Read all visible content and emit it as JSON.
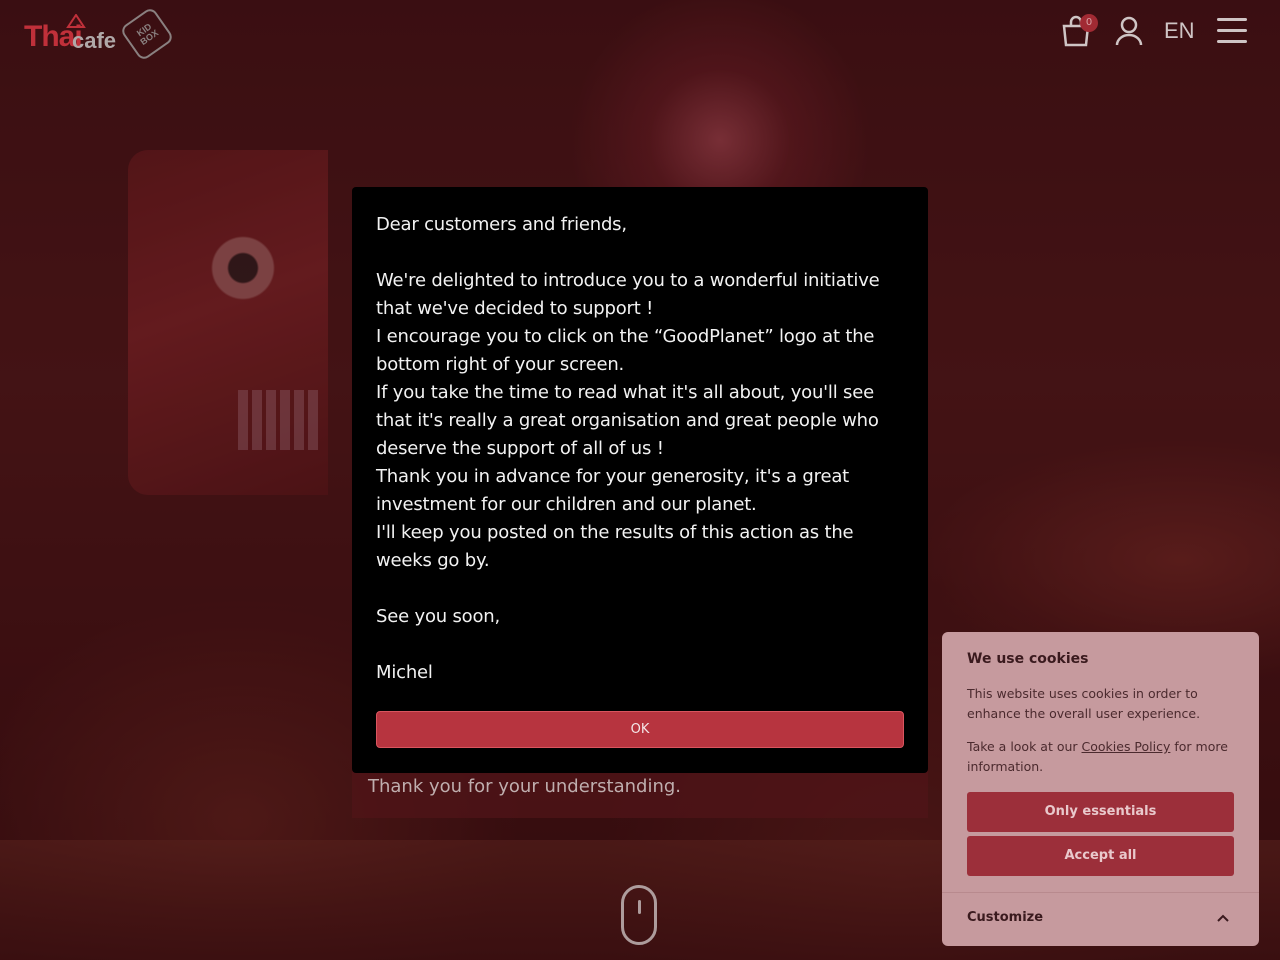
{
  "header": {
    "logo_main": "Thai",
    "logo_sub": "cafe",
    "badge_text": "KID BOX",
    "cart_count": "0",
    "language": "EN"
  },
  "modal": {
    "lines": [
      "Dear customers and friends,",
      "",
      "We're delighted to introduce you to a wonderful initiative that we've decided to support !",
      "I encourage you to click on the “GoodPlanet” logo at the bottom right of your screen.",
      "If you take the time to read what it's all about, you'll see that it's really a great organisation and great people who deserve the support of all of us !",
      "Thank you in advance for your generosity, it's a great investment for our children and our planet.",
      "I'll keep you posted on the results of this action as the weeks go by.",
      "",
      "See you soon,",
      "",
      "Michel"
    ],
    "ok_label": "OK"
  },
  "underlying": {
    "text": "Thank you for your understanding."
  },
  "cookie": {
    "title": "We use cookies",
    "text1": "This website uses cookies in order to enhance the overall user experience.",
    "text2_before": "Take a look at our ",
    "text2_link": "Cookies Policy",
    "text2_after": " for more information.",
    "only_essentials": "Only essentials",
    "accept_all": "Accept all",
    "customize": "Customize"
  },
  "colors": {
    "brand_red": "#b7343f",
    "modal_bg": "#000000",
    "cookie_bg": "#c69a9e"
  },
  "icons": [
    "crown-icon",
    "cart-icon",
    "user-icon",
    "menu-icon",
    "mouse-scroll-icon",
    "chevron-up-icon"
  ]
}
